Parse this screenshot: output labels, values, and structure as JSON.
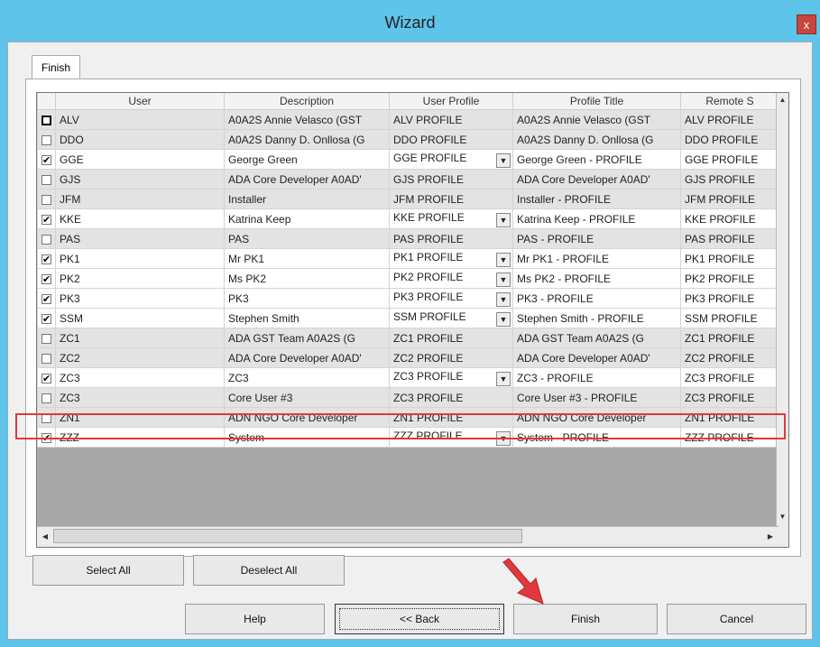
{
  "window": {
    "title": "Wizard",
    "close_label": "x"
  },
  "tab": {
    "label": "Finish"
  },
  "grid": {
    "columns": [
      "User",
      "Description",
      "User Profile",
      "Profile Title",
      "Remote S"
    ],
    "rows": [
      {
        "checked": false,
        "bold_box": true,
        "user": "ALV",
        "description": "A0A2S Annie Velasco (GST",
        "profile": "ALV PROFILE",
        "has_dropdown": false,
        "title": "A0A2S Annie Velasco (GST",
        "remote": "ALV PROFILE"
      },
      {
        "checked": false,
        "bold_box": false,
        "user": "DDO",
        "description": "A0A2S Danny D. Onllosa (G",
        "profile": "DDO PROFILE",
        "has_dropdown": false,
        "title": "A0A2S Danny D. Onllosa (G",
        "remote": "DDO PROFILE"
      },
      {
        "checked": true,
        "bold_box": false,
        "user": "GGE",
        "description": "George Green",
        "profile": "GGE PROFILE",
        "has_dropdown": true,
        "title": "George Green - PROFILE",
        "remote": "GGE PROFILE"
      },
      {
        "checked": false,
        "bold_box": false,
        "user": "GJS",
        "description": "ADA Core Developer A0AD'",
        "profile": "GJS PROFILE",
        "has_dropdown": false,
        "title": "ADA Core Developer A0AD'",
        "remote": "GJS PROFILE"
      },
      {
        "checked": false,
        "bold_box": false,
        "user": "JFM",
        "description": "Installer",
        "profile": "JFM PROFILE",
        "has_dropdown": false,
        "title": "Installer - PROFILE",
        "remote": "JFM PROFILE"
      },
      {
        "checked": true,
        "bold_box": false,
        "user": "KKE",
        "description": "Katrina Keep",
        "profile": "KKE PROFILE",
        "has_dropdown": true,
        "title": "Katrina Keep - PROFILE",
        "remote": "KKE PROFILE"
      },
      {
        "checked": false,
        "bold_box": false,
        "user": "PAS",
        "description": "PAS",
        "profile": "PAS PROFILE",
        "has_dropdown": false,
        "title": "PAS - PROFILE",
        "remote": "PAS PROFILE"
      },
      {
        "checked": true,
        "bold_box": false,
        "user": "PK1",
        "description": "Mr PK1",
        "profile": "PK1 PROFILE",
        "has_dropdown": true,
        "title": "Mr PK1 - PROFILE",
        "remote": "PK1 PROFILE"
      },
      {
        "checked": true,
        "bold_box": false,
        "user": "PK2",
        "description": "Ms PK2",
        "profile": "PK2 PROFILE",
        "has_dropdown": true,
        "title": "Ms PK2 - PROFILE",
        "remote": "PK2 PROFILE"
      },
      {
        "checked": true,
        "bold_box": false,
        "user": "PK3",
        "description": "PK3",
        "profile": "PK3 PROFILE",
        "has_dropdown": true,
        "title": "PK3 - PROFILE",
        "remote": "PK3 PROFILE"
      },
      {
        "checked": true,
        "bold_box": false,
        "user": "SSM",
        "description": "Stephen Smith",
        "profile": "SSM PROFILE",
        "has_dropdown": true,
        "title": "Stephen Smith - PROFILE",
        "remote": "SSM PROFILE"
      },
      {
        "checked": false,
        "bold_box": false,
        "user": "ZC1",
        "description": "ADA GST Team A0A2S (G",
        "profile": "ZC1 PROFILE",
        "has_dropdown": false,
        "title": "ADA GST Team A0A2S (G",
        "remote": "ZC1 PROFILE"
      },
      {
        "checked": false,
        "bold_box": false,
        "user": "ZC2",
        "description": "ADA Core Developer A0AD'",
        "profile": "ZC2 PROFILE",
        "has_dropdown": false,
        "title": "ADA Core Developer A0AD'",
        "remote": "ZC2 PROFILE"
      },
      {
        "checked": true,
        "bold_box": false,
        "user": "ZC3",
        "description": "ZC3",
        "profile": "ZC3 PROFILE",
        "has_dropdown": true,
        "title": "ZC3 - PROFILE",
        "remote": "ZC3 PROFILE"
      },
      {
        "checked": false,
        "bold_box": false,
        "user": "ZC3",
        "description": "Core User #3",
        "profile": "ZC3 PROFILE",
        "has_dropdown": false,
        "title": "Core User #3 - PROFILE",
        "remote": "ZC3 PROFILE"
      },
      {
        "checked": false,
        "bold_box": false,
        "user": "ZN1",
        "description": "ADN NGO Core Developer",
        "profile": "ZN1 PROFILE",
        "has_dropdown": false,
        "title": "ADN NGO Core Developer",
        "remote": "ZN1 PROFILE"
      },
      {
        "checked": true,
        "bold_box": false,
        "user": "ZZZ",
        "description": "System",
        "profile": "ZZZ PROFILE",
        "has_dropdown": true,
        "title": "System - PROFILE",
        "remote": "ZZZ PROFILE"
      }
    ]
  },
  "buttons": {
    "select_all": "Select All",
    "deselect_all": "Deselect All",
    "help": "Help",
    "back": "<< Back",
    "finish": "Finish",
    "cancel": "Cancel"
  },
  "icons": {
    "check_mark": "✔",
    "dropdown": "▼",
    "scroll_up": "▲",
    "scroll_down": "▼",
    "scroll_left": "◀",
    "scroll_right": "▶"
  },
  "colors": {
    "titlebar": "#5ec4ea",
    "highlight": "#e0393c",
    "arrow": "#e0393c"
  }
}
